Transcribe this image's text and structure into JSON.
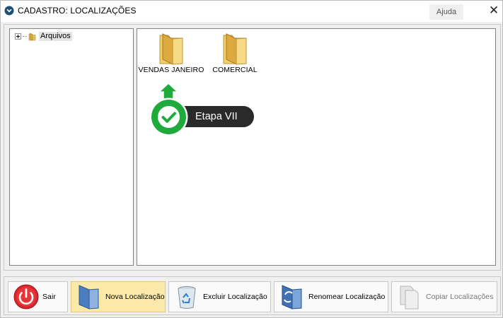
{
  "window": {
    "title": "CADASTRO: LOCALIZAÇÕES",
    "help_label": "Ajuda",
    "close_glyph": "✕"
  },
  "tree": {
    "root_label": "Arquivos",
    "root_icon": "folder-icon",
    "expanded": false
  },
  "folders": [
    {
      "label": "VENDAS JANEIRO",
      "icon": "folder-icon"
    },
    {
      "label": "COMERCIAL",
      "icon": "folder-icon"
    }
  ],
  "callout": {
    "label": "Etapa VII",
    "icon": "check-circle-icon",
    "accent": "#1faa3c"
  },
  "toolbar": {
    "buttons": [
      {
        "id": "sair",
        "label": "Sair",
        "icon": "power-icon",
        "state": "normal"
      },
      {
        "id": "nova",
        "label": "Nova Localização",
        "icon": "new-folder-icon",
        "state": "active"
      },
      {
        "id": "excluir",
        "label": "Excluir Localização",
        "icon": "recycle-bin-icon",
        "state": "normal"
      },
      {
        "id": "renomear",
        "label": "Renomear Localização",
        "icon": "rename-icon",
        "state": "normal"
      },
      {
        "id": "copiar",
        "label": "Copiar Localizações",
        "icon": "copy-icon",
        "state": "disabled"
      }
    ]
  },
  "colors": {
    "active_button": "#fae9a8",
    "folder": "#e9c25a",
    "exit_red": "#d8252c"
  }
}
